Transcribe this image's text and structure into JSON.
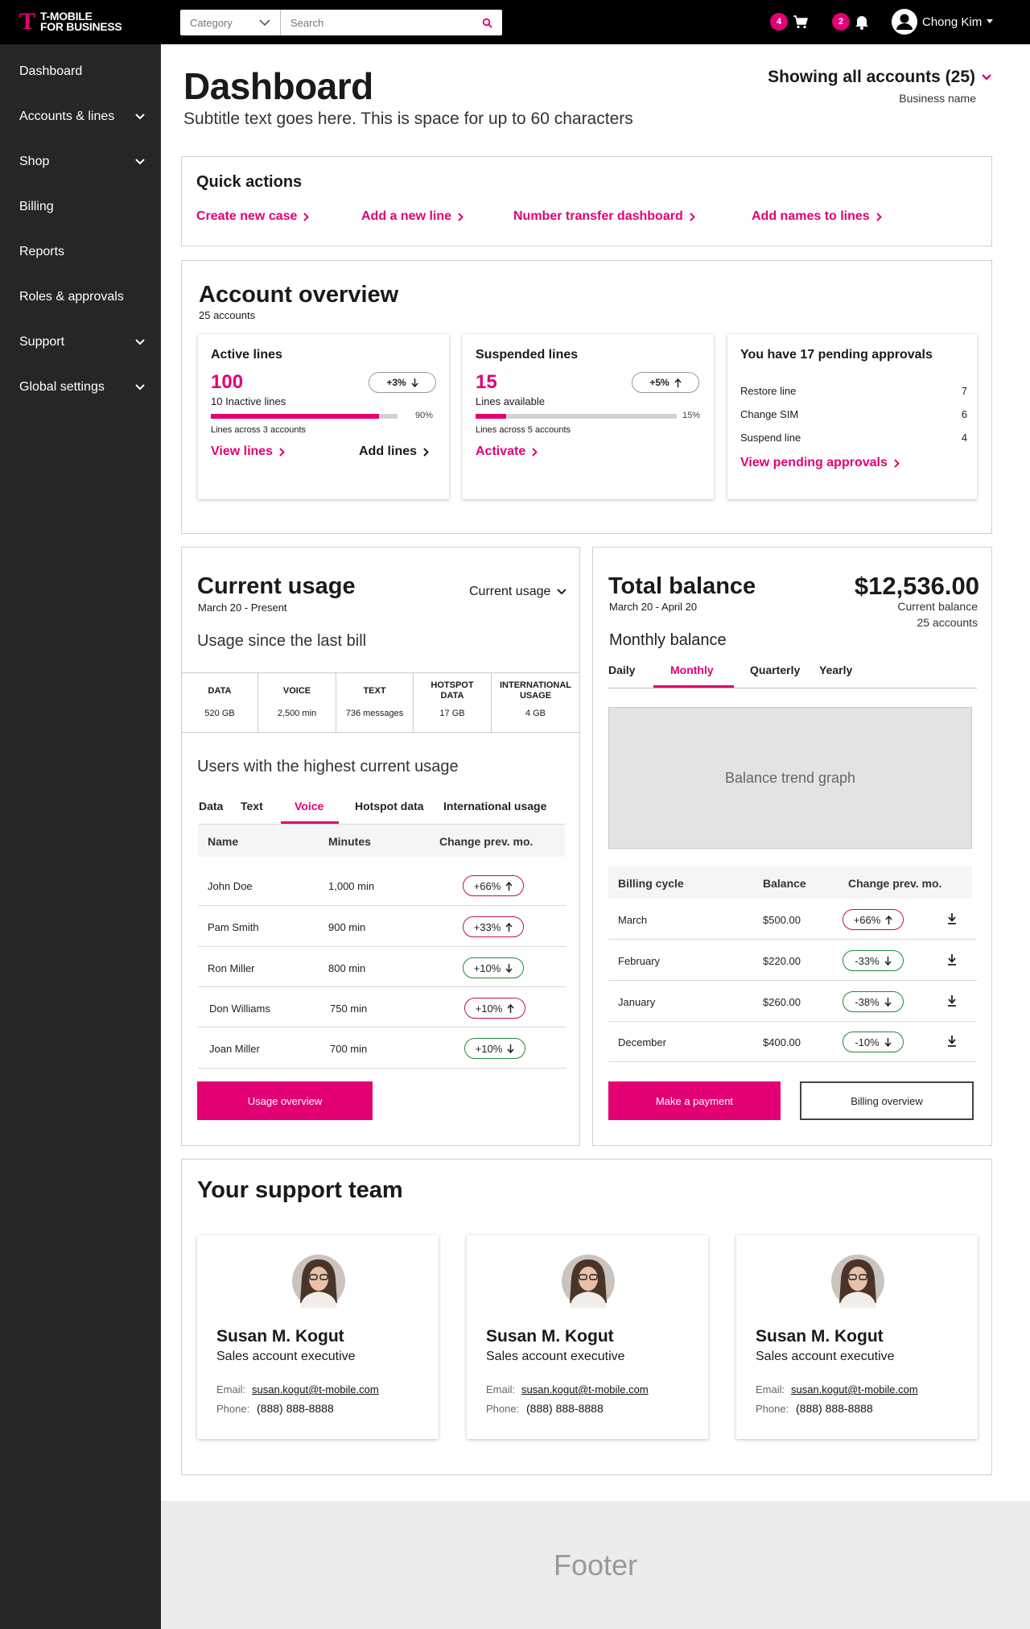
{
  "brand": {
    "logo_line1": "T-MOBILE",
    "logo_line2": "FOR BUSINESS",
    "logo_mark": "T",
    "accent": "#e20074"
  },
  "header": {
    "category_label": "Category",
    "search_placeholder": "Search",
    "cart_count": "4",
    "notif_count": "2",
    "user_name": "Chong Kim"
  },
  "sidebar": {
    "items": [
      {
        "label": "Dashboard",
        "has_chevron": false
      },
      {
        "label": "Accounts & lines",
        "has_chevron": true
      },
      {
        "label": "Shop",
        "has_chevron": true
      },
      {
        "label": "Billing",
        "has_chevron": false
      },
      {
        "label": "Reports",
        "has_chevron": false
      },
      {
        "label": "Roles & approvals",
        "has_chevron": false
      },
      {
        "label": "Support",
        "has_chevron": true
      },
      {
        "label": "Global settings",
        "has_chevron": true
      }
    ]
  },
  "page": {
    "title": "Dashboard",
    "subtitle": "Subtitle text goes here. This is space for up to 60 characters",
    "accounts_selector": "Showing all accounts (25)",
    "business_name": "Business name"
  },
  "quick_actions": {
    "title": "Quick actions",
    "links": [
      "Create new case",
      "Add a new line",
      "Number transfer dashboard",
      "Add names to lines"
    ]
  },
  "account_overview": {
    "title": "Account overview",
    "count": "25 accounts",
    "active": {
      "title": "Active lines",
      "value": "100",
      "change": "+3%",
      "sub": "10 Inactive lines",
      "progress": 0.9,
      "progress_label": "90%",
      "note": "Lines across 3 accounts",
      "link1": "View lines",
      "link2": "Add lines"
    },
    "suspended": {
      "title": "Suspended lines",
      "value": "15",
      "change": "+5%",
      "sub": "Lines available",
      "progress": 0.15,
      "progress_label": "15%",
      "note": "Lines across 5 accounts",
      "link1": "Activate"
    },
    "approvals": {
      "title": "You have 17 pending approvals",
      "items": [
        {
          "label": "Restore line",
          "count": "7"
        },
        {
          "label": "Change SIM",
          "count": "6"
        },
        {
          "label": "Suspend line",
          "count": "4"
        }
      ],
      "link": "View pending approvals"
    }
  },
  "usage": {
    "title": "Current usage",
    "dates": "March 20 - Present",
    "dropdown": "Current usage",
    "since": "Usage since the last bill",
    "stats": [
      {
        "label": "DATA",
        "value": "520 GB"
      },
      {
        "label": "VOICE",
        "value": "2,500 min"
      },
      {
        "label": "TEXT",
        "value": "736 messages"
      },
      {
        "label": "HOTSPOT DATA",
        "value": "17 GB"
      },
      {
        "label": "INTERNATIONAL USAGE",
        "value": "4 GB"
      }
    ],
    "top_title": "Users with the highest current usage",
    "tabs": [
      "Data",
      "Text",
      "Voice",
      "Hotspot data",
      "International usage"
    ],
    "active_tab": "Voice",
    "columns": [
      "Name",
      "Minutes",
      "Change prev. mo."
    ],
    "rows": [
      {
        "name": "John Doe",
        "minutes": "1,000 min",
        "change": "+66%",
        "dir": "up"
      },
      {
        "name": "Pam Smith",
        "minutes": "900 min",
        "change": "+33%",
        "dir": "up"
      },
      {
        "name": "Ron Miller",
        "minutes": "800 min",
        "change": "+10%",
        "dir": "down"
      },
      {
        "name": "Don Williams",
        "minutes": "750 min",
        "change": "+10%",
        "dir": "up"
      },
      {
        "name": "Joan Miller",
        "minutes": "700 min",
        "change": "+10%",
        "dir": "down"
      }
    ],
    "button": "Usage overview"
  },
  "balance": {
    "title": "Total balance",
    "dates": "March 20 - April 20",
    "amount": "$12,536.00",
    "amount_label": "Current balance",
    "accounts": "25 accounts",
    "monthly_title": "Monthly balance",
    "tabs": [
      "Daily",
      "Monthly",
      "Quarterly",
      "Yearly"
    ],
    "active_tab": "Monthly",
    "graph_placeholder": "Balance trend graph",
    "columns": [
      "Billing cycle",
      "Balance",
      "Change prev. mo."
    ],
    "rows": [
      {
        "cycle": "March",
        "balance": "$500.00",
        "change": "+66%",
        "dir": "up"
      },
      {
        "cycle": "February",
        "balance": "$220.00",
        "change": "-33%",
        "dir": "down"
      },
      {
        "cycle": "January",
        "balance": "$260.00",
        "change": "-38%",
        "dir": "down"
      },
      {
        "cycle": "December",
        "balance": "$400.00",
        "change": "-10%",
        "dir": "down"
      }
    ],
    "btn_pay": "Make a payment",
    "btn_overview": "Billing overview"
  },
  "support": {
    "title": "Your support team",
    "members": [
      {
        "name": "Susan M. Kogut",
        "role": "Sales account executive",
        "email_label": "Email:",
        "email": "susan.kogut@t-mobile.com",
        "phone_label": "Phone:",
        "phone": "(888) 888-8888"
      },
      {
        "name": "Susan M. Kogut",
        "role": "Sales account executive",
        "email_label": "Email:",
        "email": "susan.kogut@t-mobile.com",
        "phone_label": "Phone:",
        "phone": "(888) 888-8888"
      },
      {
        "name": "Susan M. Kogut",
        "role": "Sales account executive",
        "email_label": "Email:",
        "email": "susan.kogut@t-mobile.com",
        "phone_label": "Phone:",
        "phone": "(888) 888-8888"
      }
    ]
  },
  "footer": {
    "label": "Footer"
  }
}
